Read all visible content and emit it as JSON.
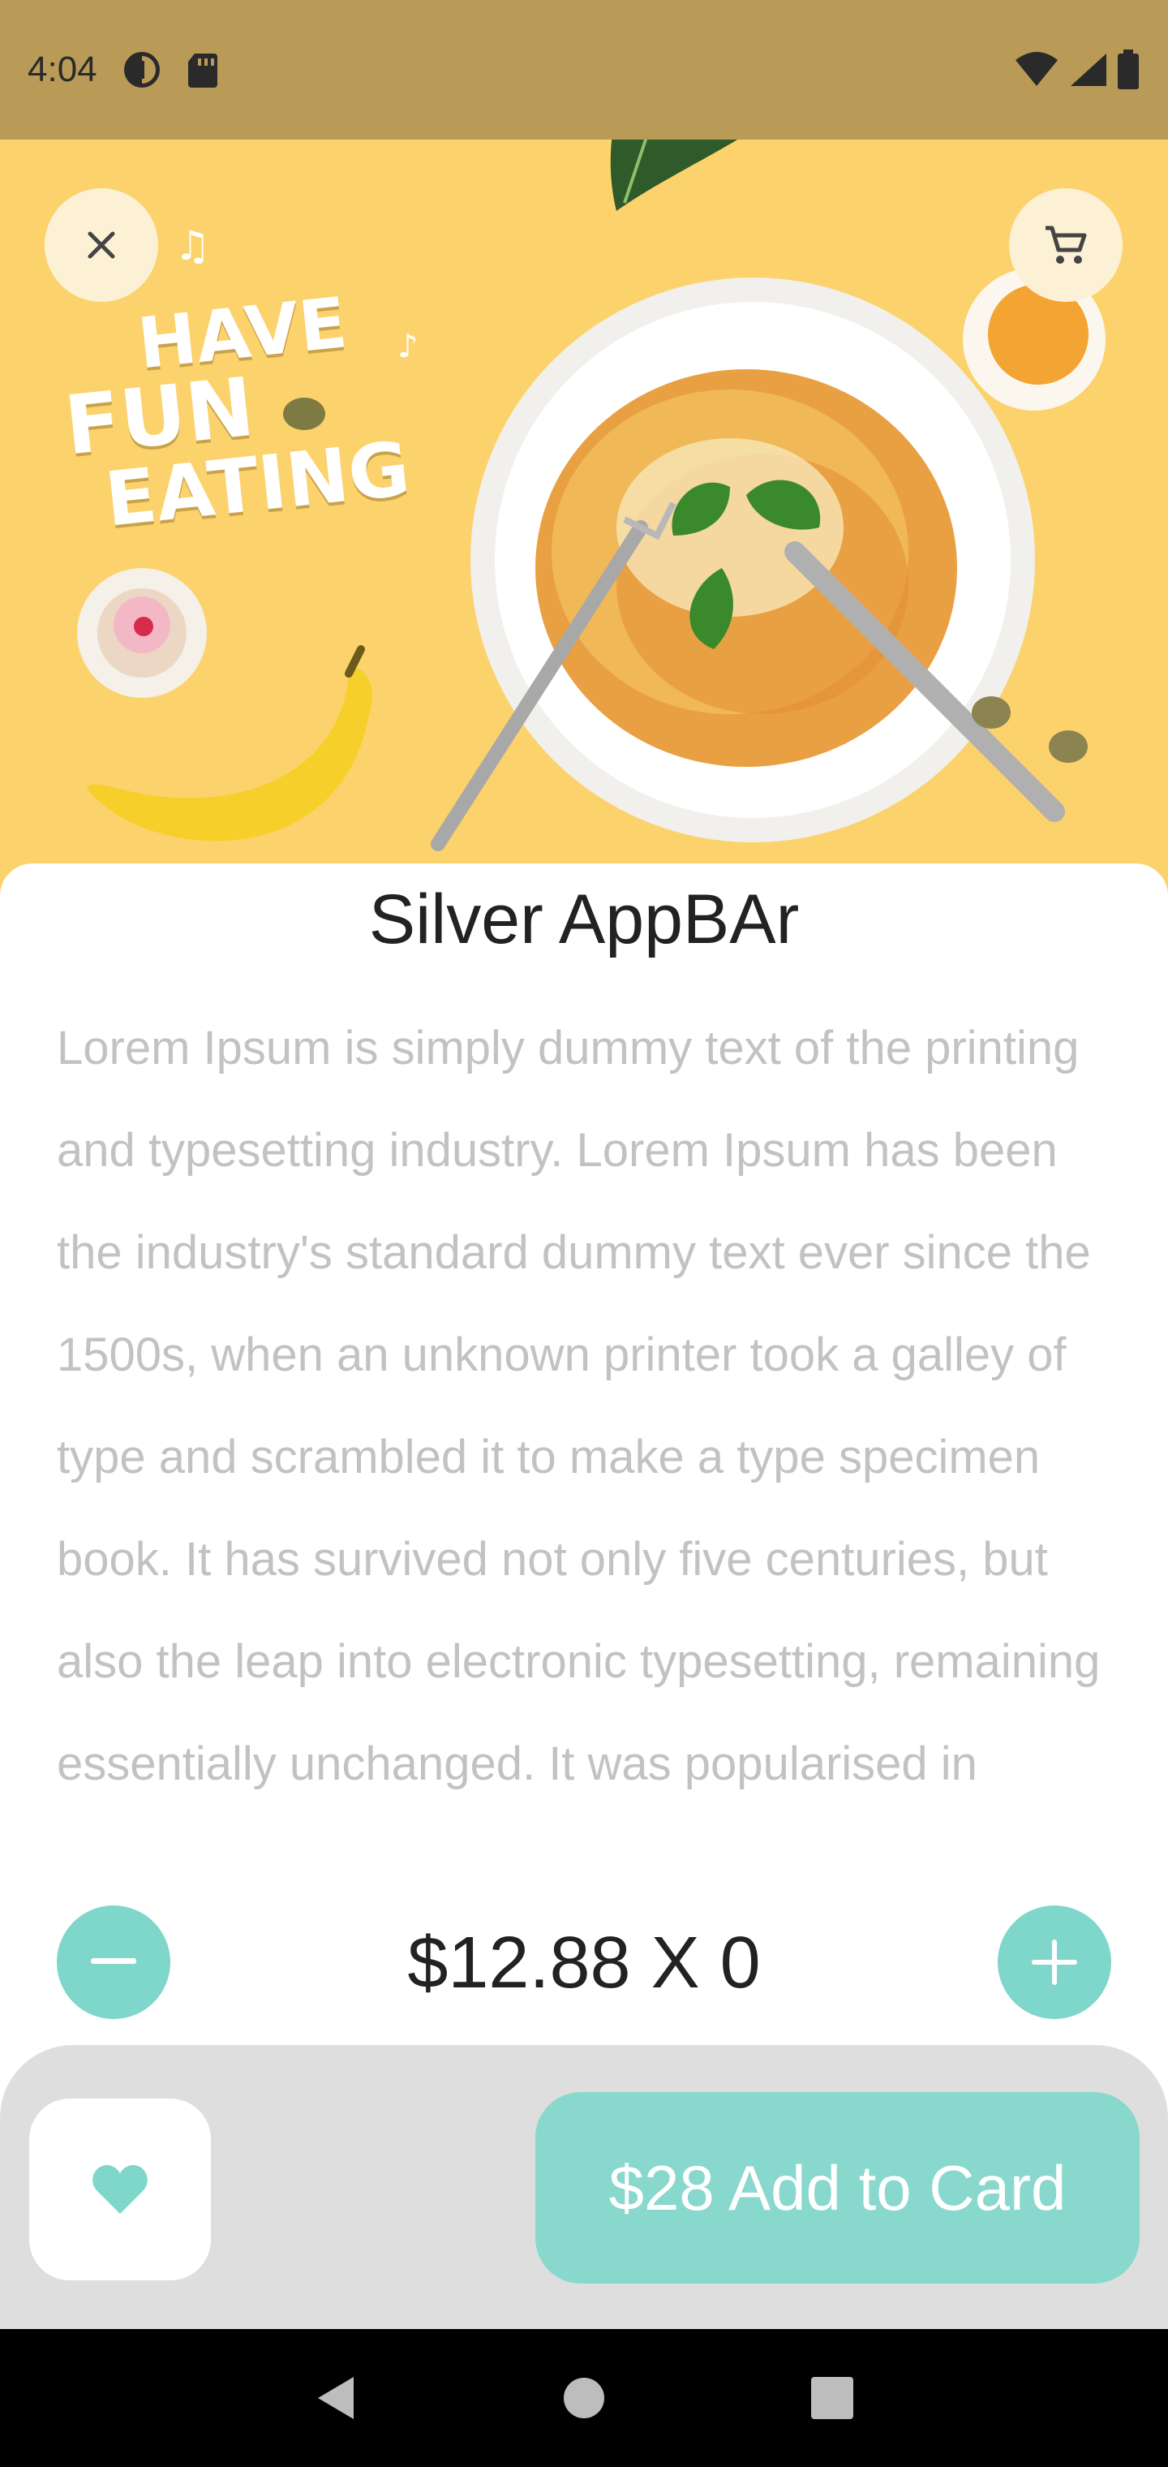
{
  "status_bar": {
    "time": "4:04",
    "icons": [
      "data-saver-icon",
      "sd-card-icon",
      "wifi-icon",
      "signal-icon",
      "battery-icon"
    ]
  },
  "hero": {
    "banner_text": [
      "HAVE",
      "FUN",
      "EATING"
    ]
  },
  "buttons": {
    "close_icon": "close-icon",
    "cart_icon": "cart-icon"
  },
  "product": {
    "title": "Silver AppBAr",
    "description": "Lorem Ipsum is simply dummy text of the printing and typesetting industry. Lorem Ipsum has been the industry's standard dummy text ever since the 1500s, when an unknown printer took a galley of type and scrambled it to make a type specimen book. It has survived not only five centuries, but also the leap into electronic typesetting, remaining essentially unchanged. It was popularised in"
  },
  "quantity": {
    "price_label": "$12.88  X 0"
  },
  "actions": {
    "add_to_cart_label": "$28 Add to Card"
  },
  "colors": {
    "accent": "#7fd6cb",
    "hero_bg": "#fcd26c",
    "status_bar_bg": "#b99a57",
    "bottom_panel_bg": "#dedede"
  }
}
